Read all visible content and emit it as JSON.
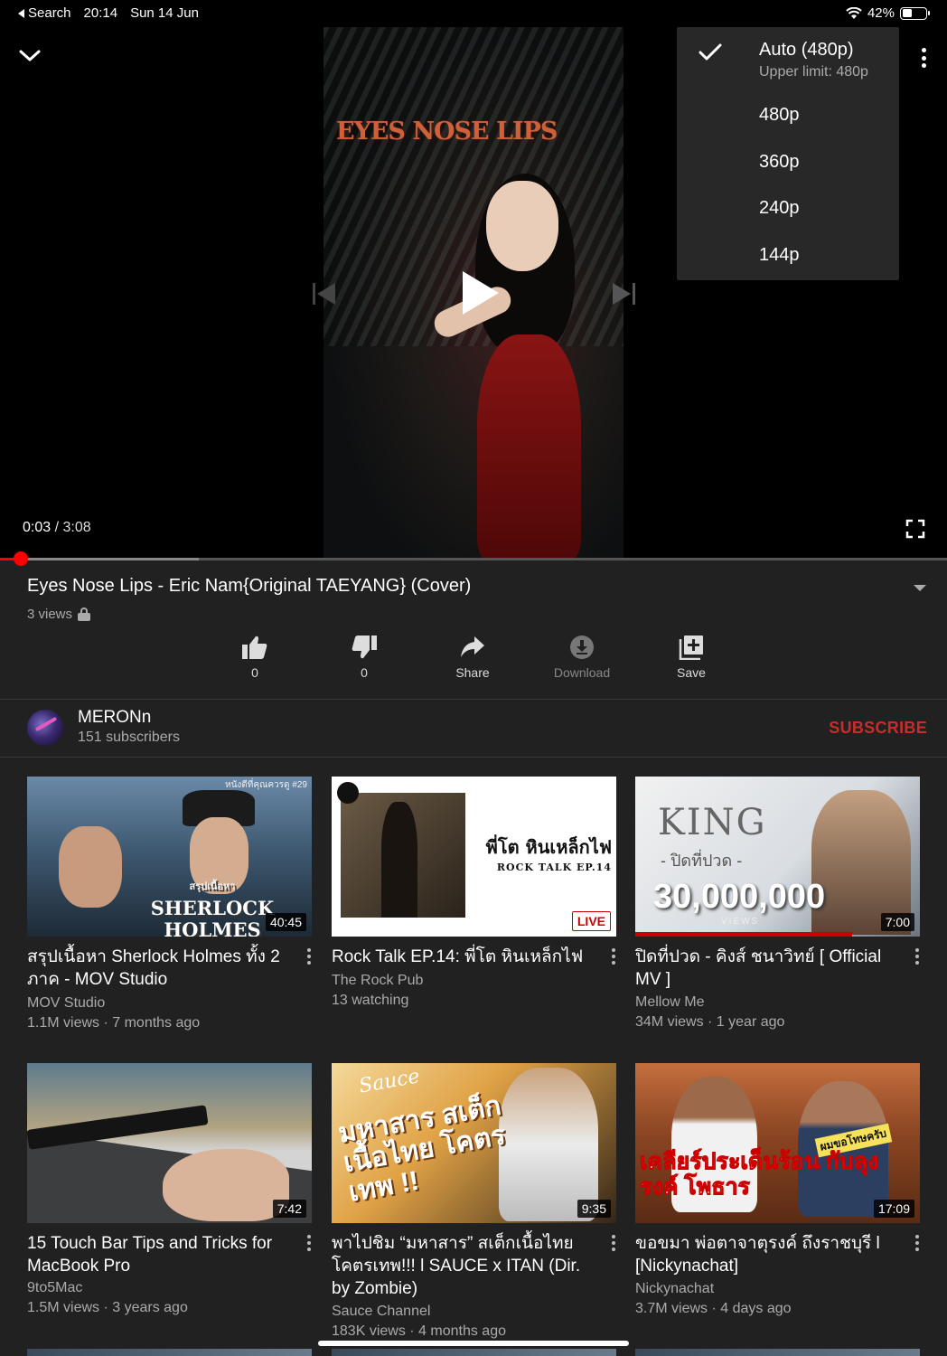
{
  "status_bar": {
    "back_label": "Search",
    "time": "20:14",
    "date": "Sun 14 Jun",
    "battery": "42%",
    "battery_level": 0.42
  },
  "player": {
    "overlay_text": "EYES NOSE LIPS",
    "current_time": "0:03",
    "separator": "/",
    "duration": "3:08",
    "progress_played": 0.022,
    "progress_buffered": 0.21
  },
  "quality_menu": {
    "items": [
      {
        "label": "Auto (480p)",
        "sub": "Upper limit: 480p",
        "selected": true
      },
      {
        "label": "480p"
      },
      {
        "label": "360p"
      },
      {
        "label": "240p"
      },
      {
        "label": "144p"
      }
    ]
  },
  "video": {
    "title": "Eyes Nose Lips - Eric Nam{Original TAEYANG} (Cover)",
    "views": "3 views"
  },
  "actions": {
    "like": "0",
    "dislike": "0",
    "share": "Share",
    "download": "Download",
    "save": "Save"
  },
  "channel": {
    "name": "MERONn",
    "subscribers": "151 subscribers",
    "subscribe_label": "SUBSCRIBE"
  },
  "recommendations": [
    {
      "title": "สรุปเนื้อหา Sherlock Holmes ทั้ง 2 ภาค - MOV Studio",
      "channel": "MOV Studio",
      "stats": "1.1M views · 7 months ago",
      "badge": "40:45",
      "thumb_text": "SHERLOCK HOLMES",
      "thumb_small": "สรุปเนื้อหา",
      "thumb_corner": "หนังดีที่คุณควรดู #29"
    },
    {
      "title": "Rock Talk EP.14: พี่โต หินเหล็กไฟ",
      "channel": "The Rock Pub",
      "stats": "13 watching",
      "badge": "LIVE",
      "thumb_text": "พี่โต หินเหล็กไฟ",
      "thumb_small": "ROCK TALK EP.14"
    },
    {
      "title": "ปิดที่ปวด - คิงส์ ชนาวิทย์ [ Official MV ]",
      "channel": "Mellow Me",
      "stats": "34M views · 1 year ago",
      "badge": "7:00",
      "thumb_text": "KING",
      "thumb_small": "- ปิดที่ปวด -",
      "thumb_num": "30,000,000",
      "thumb_views": "VIEWS"
    },
    {
      "title": "15 Touch Bar Tips and Tricks for MacBook Pro",
      "channel": "9to5Mac",
      "stats": "1.5M views · 3 years ago",
      "badge": "7:42"
    },
    {
      "title": "พาไปชิม “มหาสาร”  สเต็กเนื้อไทยโคตรเทพ!!!  l SAUCE x ITAN (Dir. by Zombie)",
      "channel": "Sauce Channel",
      "stats": "183K views · 4 months ago",
      "badge": "9:35",
      "thumb_brand": "Sauce",
      "thumb_text": "มหาสาร สเต็กเนื้อไทย โคตรเทพ !!"
    },
    {
      "title": "ขอขมา พ่อตาจาตุรงค์ ถึงราชบุรี l [Nickynachat]",
      "channel": "Nickynachat",
      "stats": "3.7M views · 4 days ago",
      "badge": "17:09",
      "thumb_top": "ผมขอโทษครับ",
      "thumb_text": "เคลียร์ประเด็นร้อน กับลุงรงค์ โพธาร"
    }
  ],
  "colors": {
    "accent": "#ff0000",
    "subscribe": "#cc2b2b",
    "background": "#212121"
  }
}
